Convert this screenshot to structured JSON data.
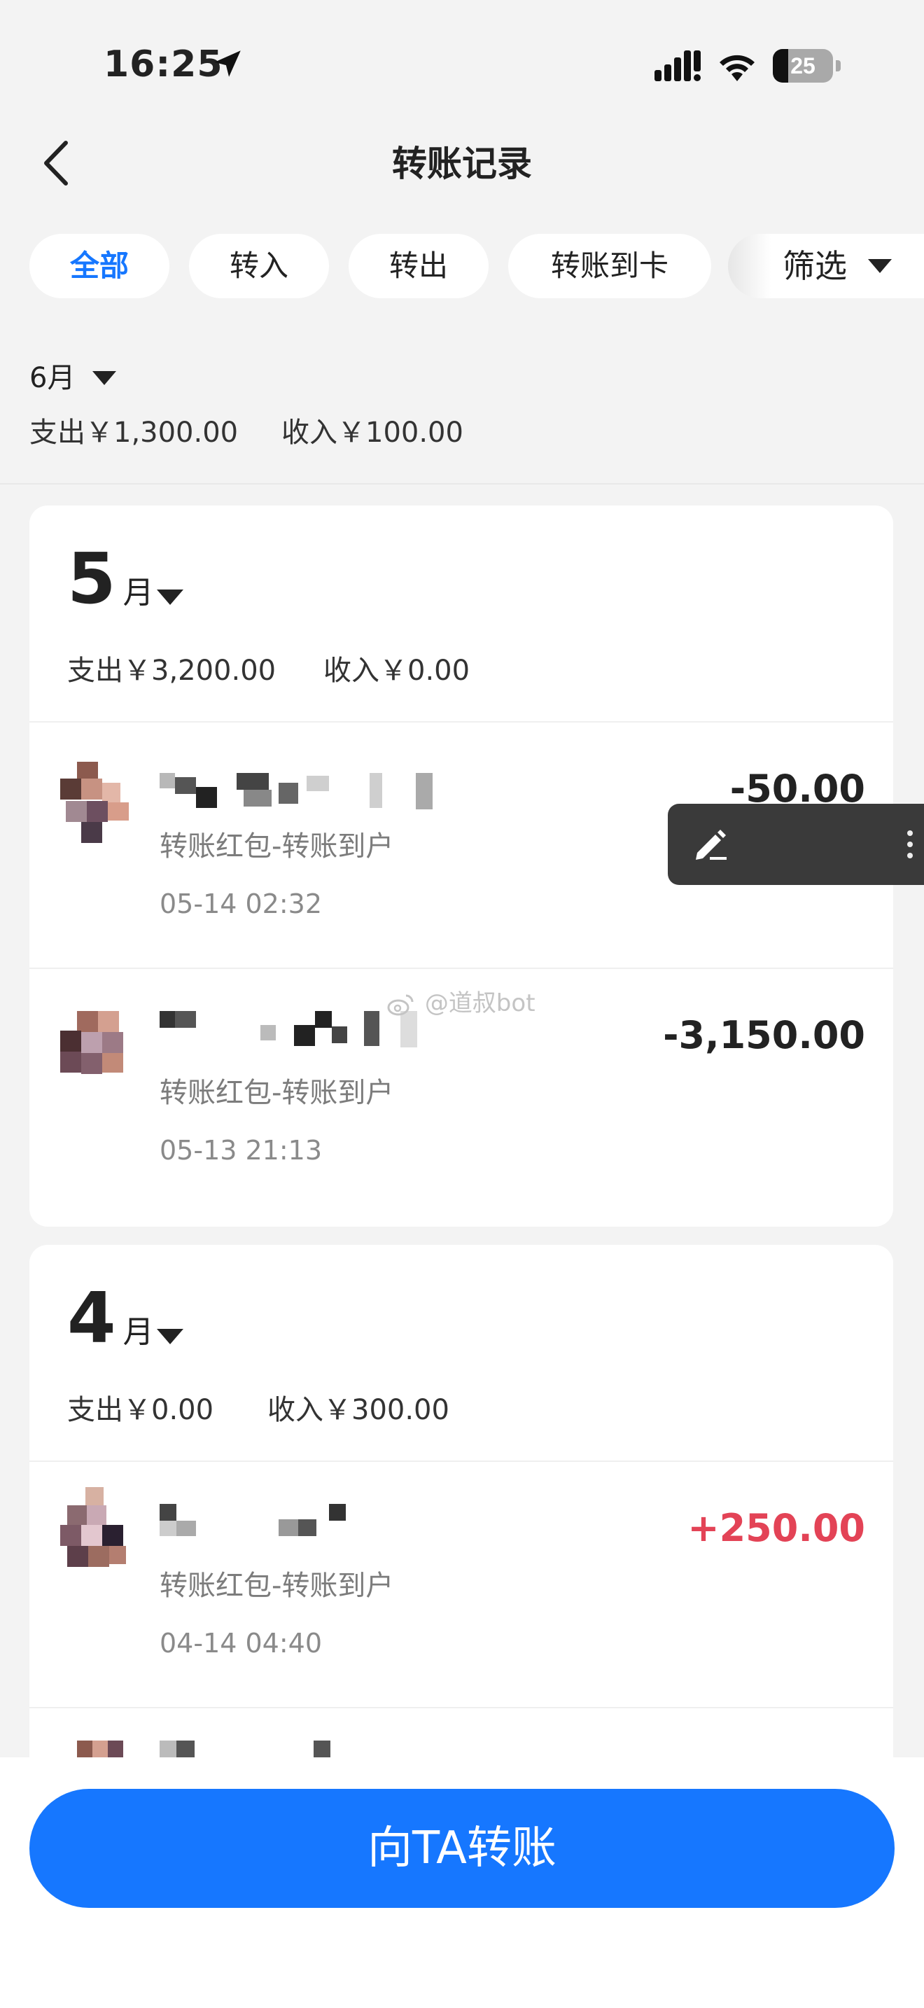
{
  "status_bar": {
    "time": "16:25",
    "battery": "25",
    "battery_level": 0.25
  },
  "nav": {
    "title": "转账记录"
  },
  "filters": {
    "tabs": [
      {
        "label": "全部",
        "active": true
      },
      {
        "label": "转入",
        "active": false
      },
      {
        "label": "转出",
        "active": false
      },
      {
        "label": "转账到卡",
        "active": false
      }
    ],
    "filter_label": "筛选"
  },
  "current_month": {
    "label": "6月",
    "expense": "支出￥1,300.00",
    "income": "收入￥100.00"
  },
  "months": [
    {
      "label_num": "5",
      "label_unit": "月",
      "expense": "支出￥3,200.00",
      "income": "收入￥0.00",
      "transactions": [
        {
          "name": "",
          "desc": "转账红包-转账到户",
          "datetime": "05-14 02:32",
          "amount": "-50.00",
          "type": "out"
        },
        {
          "name": "",
          "desc": "转账红包-转账到户",
          "datetime": "05-13 21:13",
          "amount": "-3,150.00",
          "type": "out"
        }
      ]
    },
    {
      "label_num": "4",
      "label_unit": "月",
      "expense": "支出￥0.00",
      "income": "收入￥300.00",
      "transactions": [
        {
          "name": "",
          "desc": "转账红包-转账到户",
          "datetime": "04-14 04:40",
          "amount": "+250.00",
          "type": "in"
        }
      ]
    }
  ],
  "watermark": "@道叔bot",
  "cta": {
    "label": "向TA转账"
  },
  "colors": {
    "accent": "#1677ff",
    "income": "#e34356",
    "background": "#f3f3f3"
  },
  "icons": {
    "back": "chevron-left-icon",
    "location": "location-arrow-icon",
    "signal": "cellular-signal-icon",
    "wifi": "wifi-icon",
    "battery": "battery-icon",
    "caret": "caret-down-icon",
    "edit": "pen-icon",
    "more": "more-vertical-icon",
    "watermark": "weibo-icon"
  }
}
